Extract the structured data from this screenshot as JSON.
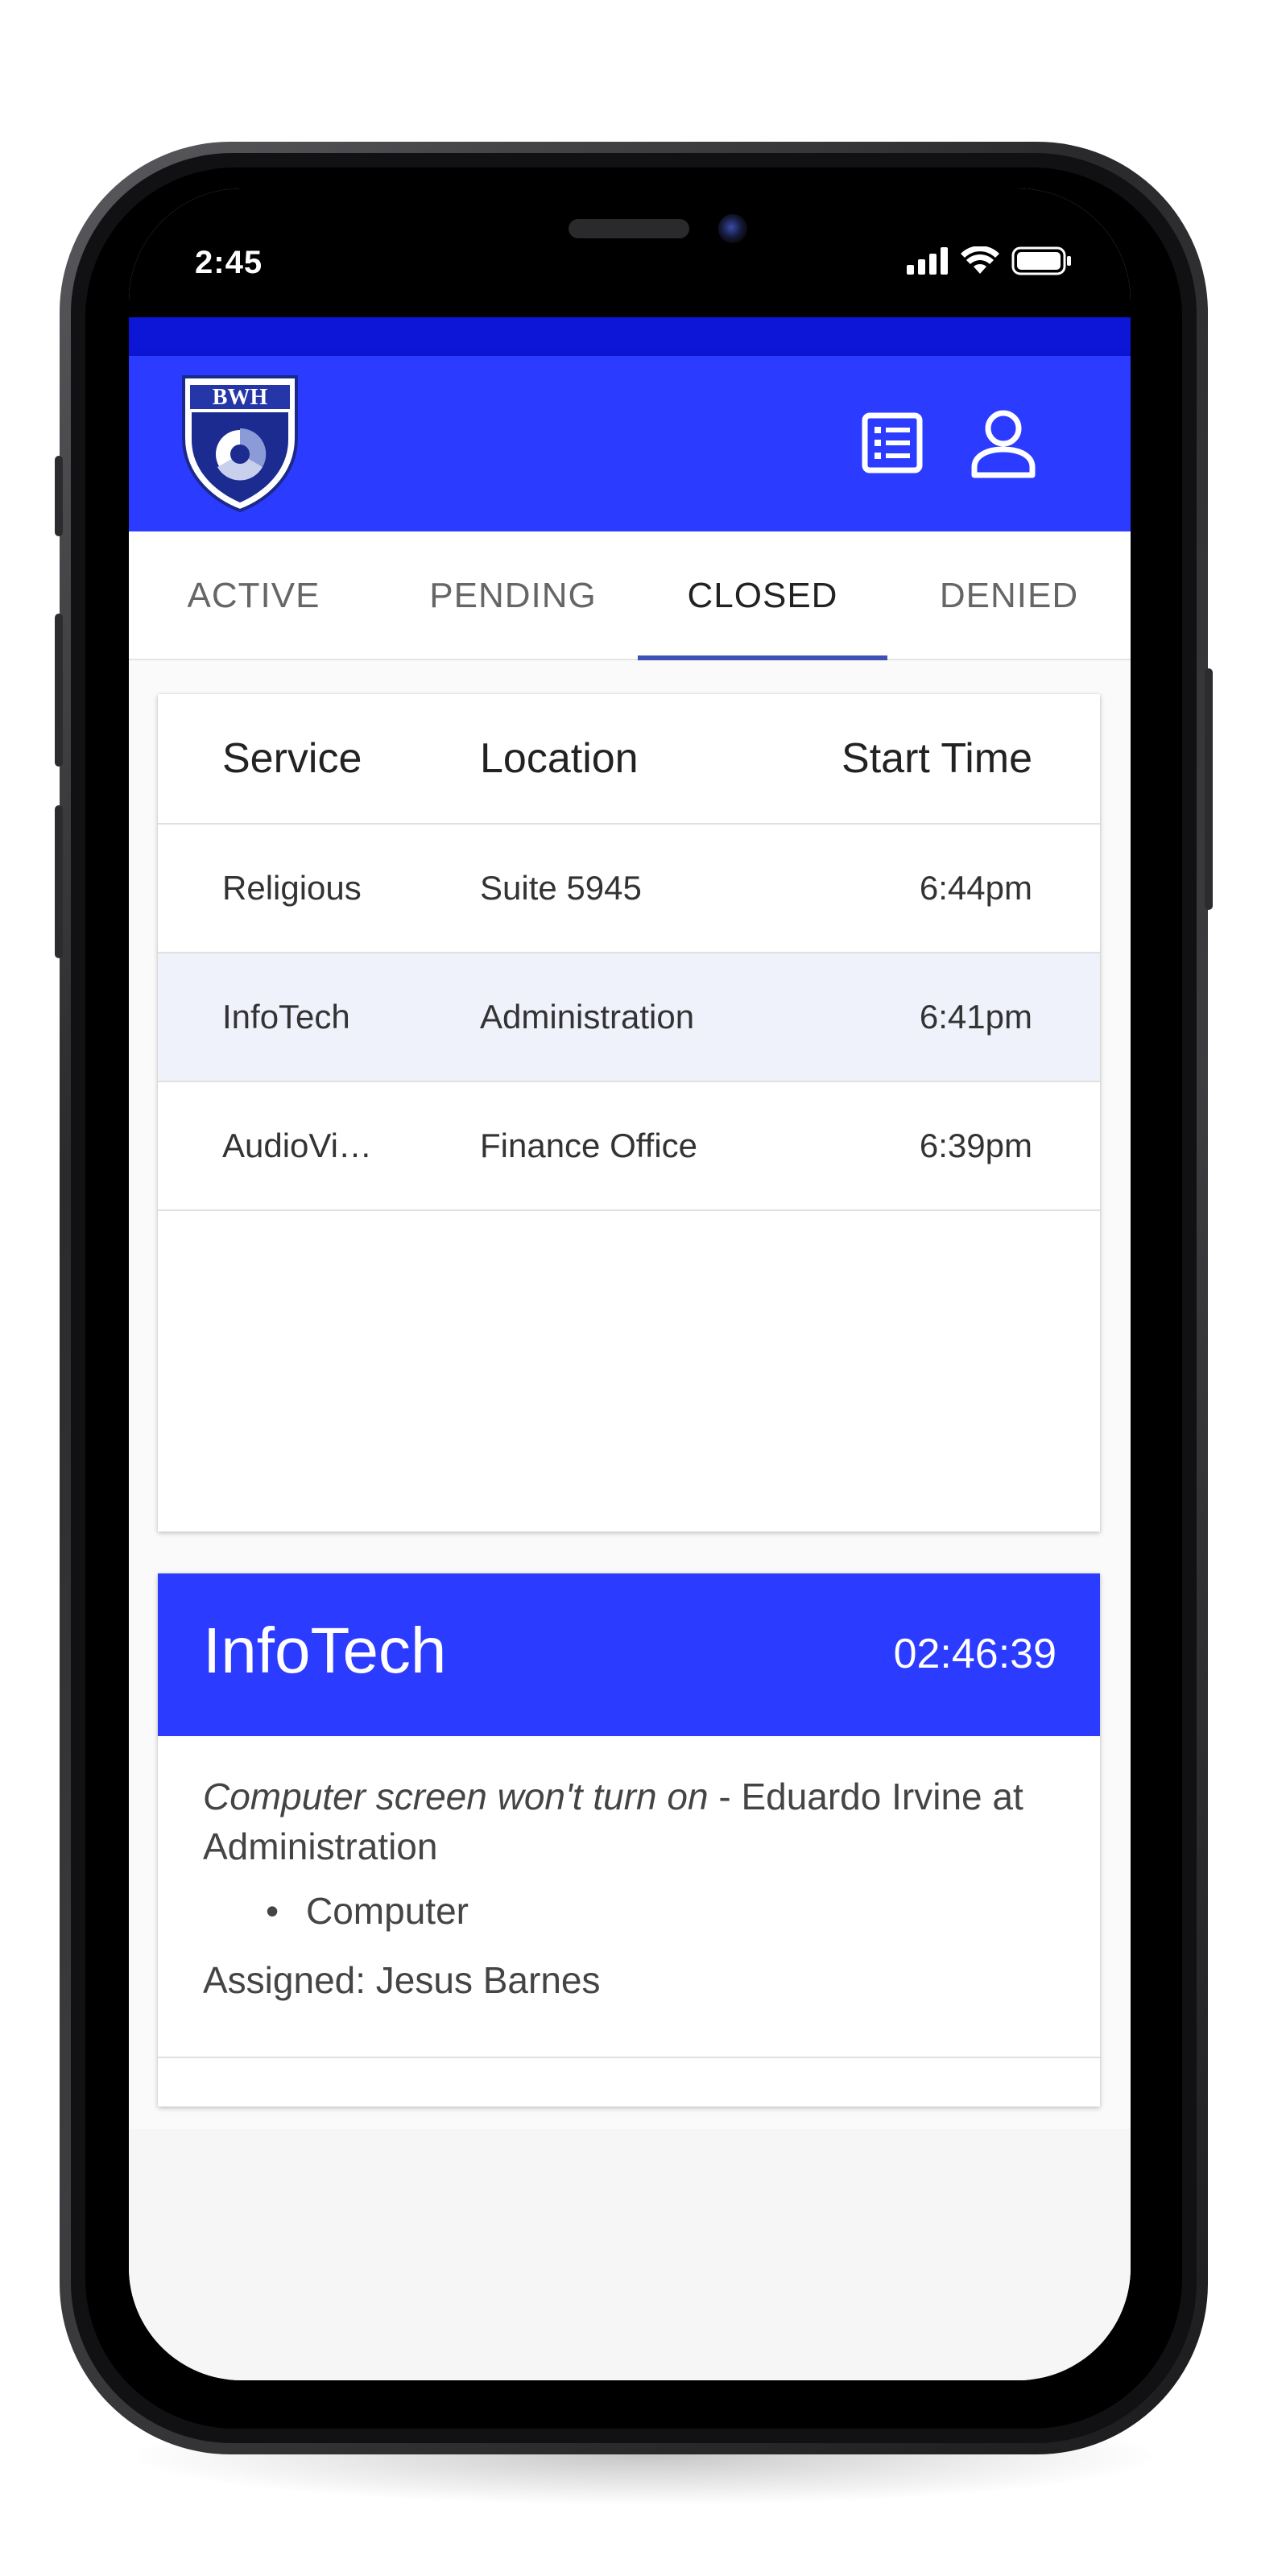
{
  "status_bar": {
    "time": "2:45"
  },
  "app_bar": {
    "logo_text": "BWH",
    "colors": {
      "primary": "#2b3bff",
      "strip": "#0d16d6",
      "tab_indicator": "#3f51b5"
    }
  },
  "tabs": [
    {
      "label": "ACTIVE",
      "selected": false
    },
    {
      "label": "PENDING",
      "selected": false
    },
    {
      "label": "CLOSED",
      "selected": true
    },
    {
      "label": "DENIED",
      "selected": false
    }
  ],
  "table": {
    "headers": {
      "service": "Service",
      "location": "Location",
      "start_time": "Start Time"
    },
    "rows": [
      {
        "service": "Religious",
        "location": "Suite 5945",
        "start_time": "6:44pm",
        "selected": false
      },
      {
        "service": "InfoTech",
        "location": "Administration",
        "start_time": "6:41pm",
        "selected": true
      },
      {
        "service": "AudioVi…",
        "location": "Finance Office",
        "start_time": "6:39pm",
        "selected": false
      }
    ]
  },
  "detail": {
    "title": "InfoTech",
    "timer": "02:46:39",
    "description": "Computer screen won't turn on",
    "separator": " - ",
    "requester": "Eduardo Irvine at Administration",
    "items": [
      "Computer"
    ],
    "assigned_label": "Assigned: Jesus Barnes"
  },
  "icons": {
    "list": "list-icon",
    "account": "account-icon",
    "signal": "signal-icon",
    "wifi": "wifi-icon",
    "battery": "battery-icon"
  }
}
